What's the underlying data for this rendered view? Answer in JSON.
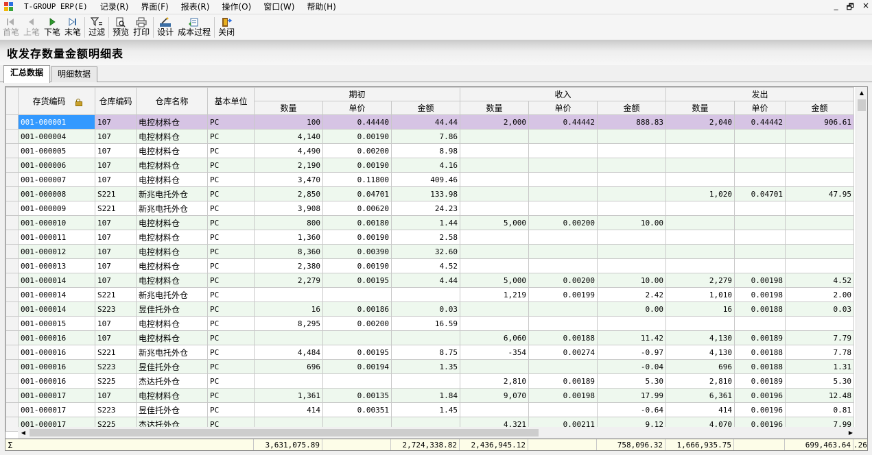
{
  "menubar": {
    "items": [
      "T-GROUP ERP(E)",
      "记录(R)",
      "界面(F)",
      "报表(R)",
      "操作(O)",
      "窗口(W)",
      "帮助(H)"
    ],
    "window_controls": [
      "_",
      "🗗",
      "×"
    ]
  },
  "toolbar": {
    "first": "首笔",
    "prev": "上笔",
    "next": "下笔",
    "last": "末笔",
    "filter": "过滤",
    "preview": "预览",
    "print": "打印",
    "design": "设计",
    "cost_process": "成本过程",
    "close": "关闭"
  },
  "page_title": "收发存数量金额明细表",
  "tabs": [
    "汇总数据",
    "明细数据"
  ],
  "grid": {
    "headers": {
      "item_code": "存货编码",
      "wh_code": "仓库编码",
      "wh_name": "仓库名称",
      "unit": "基本单位",
      "opening": "期初",
      "receipt": "收入",
      "issue": "发出",
      "qty": "数量",
      "price": "单价",
      "amount": "金额"
    },
    "rows": [
      [
        "001-000001",
        "107",
        "电控材料仓",
        "PC",
        "100",
        "0.44440",
        "44.44",
        "2,000",
        "0.44442",
        "888.83",
        "2,040",
        "0.44442",
        "906.61"
      ],
      [
        "001-000004",
        "107",
        "电控材料仓",
        "PC",
        "4,140",
        "0.00190",
        "7.86",
        "",
        "",
        "",
        "",
        "",
        ""
      ],
      [
        "001-000005",
        "107",
        "电控材料仓",
        "PC",
        "4,490",
        "0.00200",
        "8.98",
        "",
        "",
        "",
        "",
        "",
        ""
      ],
      [
        "001-000006",
        "107",
        "电控材料仓",
        "PC",
        "2,190",
        "0.00190",
        "4.16",
        "",
        "",
        "",
        "",
        "",
        ""
      ],
      [
        "001-000007",
        "107",
        "电控材料仓",
        "PC",
        "3,470",
        "0.11800",
        "409.46",
        "",
        "",
        "",
        "",
        "",
        ""
      ],
      [
        "001-000008",
        "S221",
        "新兆电托外仓",
        "PC",
        "2,850",
        "0.04701",
        "133.98",
        "",
        "",
        "",
        "1,020",
        "0.04701",
        "47.95"
      ],
      [
        "001-000009",
        "S221",
        "新兆电托外仓",
        "PC",
        "3,908",
        "0.00620",
        "24.23",
        "",
        "",
        "",
        "",
        "",
        ""
      ],
      [
        "001-000010",
        "107",
        "电控材料仓",
        "PC",
        "800",
        "0.00180",
        "1.44",
        "5,000",
        "0.00200",
        "10.00",
        "",
        "",
        ""
      ],
      [
        "001-000011",
        "107",
        "电控材料仓",
        "PC",
        "1,360",
        "0.00190",
        "2.58",
        "",
        "",
        "",
        "",
        "",
        ""
      ],
      [
        "001-000012",
        "107",
        "电控材料仓",
        "PC",
        "8,360",
        "0.00390",
        "32.60",
        "",
        "",
        "",
        "",
        "",
        ""
      ],
      [
        "001-000013",
        "107",
        "电控材料仓",
        "PC",
        "2,380",
        "0.00190",
        "4.52",
        "",
        "",
        "",
        "",
        "",
        ""
      ],
      [
        "001-000014",
        "107",
        "电控材料仓",
        "PC",
        "2,279",
        "0.00195",
        "4.44",
        "5,000",
        "0.00200",
        "10.00",
        "2,279",
        "0.00198",
        "4.52"
      ],
      [
        "001-000014",
        "S221",
        "新兆电托外仓",
        "PC",
        "",
        "",
        "",
        "1,219",
        "0.00199",
        "2.42",
        "1,010",
        "0.00198",
        "2.00"
      ],
      [
        "001-000014",
        "S223",
        "昱佳托外仓",
        "PC",
        "16",
        "0.00186",
        "0.03",
        "",
        "",
        "0.00",
        "16",
        "0.00188",
        "0.03"
      ],
      [
        "001-000015",
        "107",
        "电控材料仓",
        "PC",
        "8,295",
        "0.00200",
        "16.59",
        "",
        "",
        "",
        "",
        "",
        ""
      ],
      [
        "001-000016",
        "107",
        "电控材料仓",
        "PC",
        "",
        "",
        "",
        "6,060",
        "0.00188",
        "11.42",
        "4,130",
        "0.00189",
        "7.79"
      ],
      [
        "001-000016",
        "S221",
        "新兆电托外仓",
        "PC",
        "4,484",
        "0.00195",
        "8.75",
        "-354",
        "0.00274",
        "-0.97",
        "4,130",
        "0.00188",
        "7.78"
      ],
      [
        "001-000016",
        "S223",
        "昱佳托外仓",
        "PC",
        "696",
        "0.00194",
        "1.35",
        "",
        "",
        "-0.04",
        "696",
        "0.00188",
        "1.31"
      ],
      [
        "001-000016",
        "S225",
        "杰达托外仓",
        "PC",
        "",
        "",
        "",
        "2,810",
        "0.00189",
        "5.30",
        "2,810",
        "0.00189",
        "5.30"
      ],
      [
        "001-000017",
        "107",
        "电控材料仓",
        "PC",
        "1,361",
        "0.00135",
        "1.84",
        "9,070",
        "0.00198",
        "17.99",
        "6,361",
        "0.00196",
        "12.48"
      ],
      [
        "001-000017",
        "S223",
        "昱佳托外仓",
        "PC",
        "414",
        "0.00351",
        "1.45",
        "",
        "",
        "-0.64",
        "414",
        "0.00196",
        "0.81"
      ],
      [
        "001-000017",
        "S225",
        "杰达托外仓",
        "PC",
        "",
        "",
        "",
        "4,321",
        "0.00211",
        "9.12",
        "4,070",
        "0.00196",
        "7.99"
      ]
    ],
    "footer": {
      "sigma": "Σ",
      "opening_qty": "3,631,075.89",
      "opening_amount": "2,724,338.82",
      "receipt_qty": "2,436,945.12",
      "receipt_amount": "758,096.32",
      "issue_qty": "1,666,935.75",
      "issue_amount": "699,463.64",
      "overflow": ".26"
    }
  }
}
